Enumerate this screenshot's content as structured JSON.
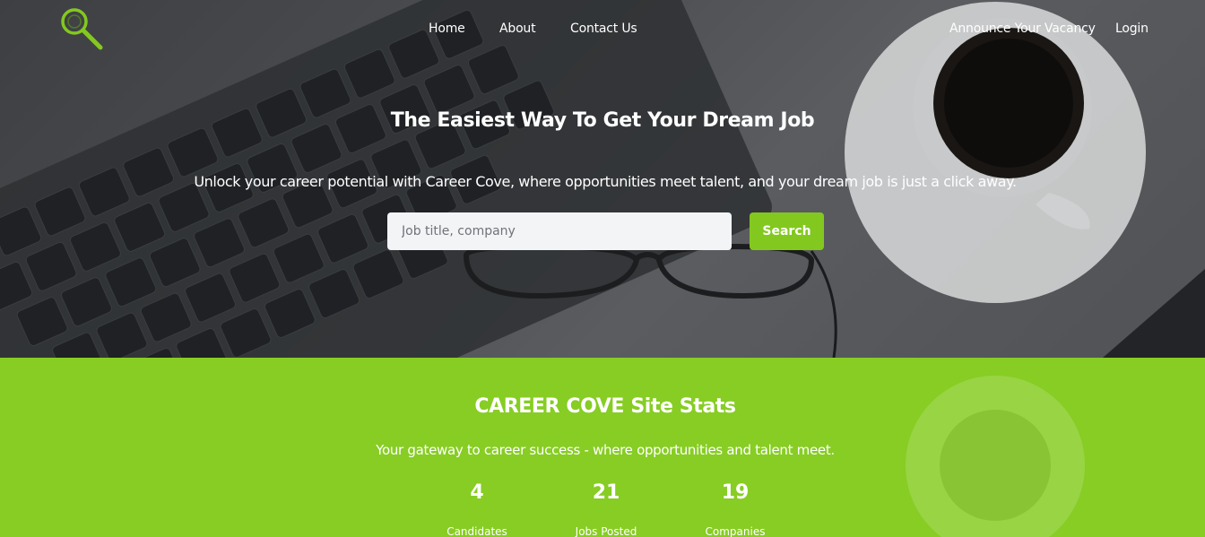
{
  "brand": {
    "logo_icon": "magnifier-logo-icon",
    "accent_color": "#83c81f"
  },
  "nav": {
    "home": "Home",
    "about": "About",
    "contact": "Contact Us",
    "announce": "Announce Your Vacancy",
    "login": "Login"
  },
  "hero": {
    "title": "The Easiest Way To Get Your Dream Job",
    "subtitle": "Unlock your career potential with Career Cove, where opportunities meet talent, and your dream job is just a click away.",
    "search_placeholder": "Job title, company",
    "search_button": "Search"
  },
  "stats": {
    "title": "CAREER COVE Site Stats",
    "subtitle": "Your gateway to career success - where opportunities and talent meet.",
    "items": [
      {
        "value": "4",
        "label": "Candidates"
      },
      {
        "value": "21",
        "label": "Jobs Posted"
      },
      {
        "value": "19",
        "label": "Companies"
      }
    ]
  }
}
